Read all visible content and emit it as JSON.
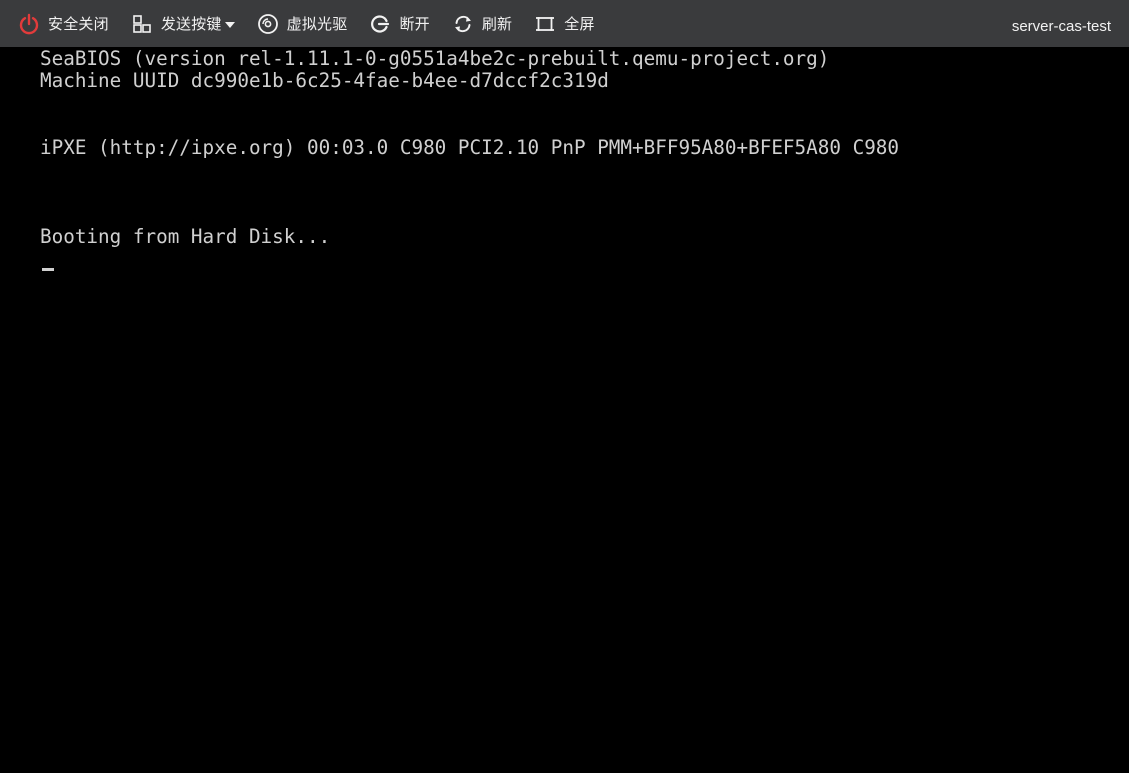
{
  "toolbar": {
    "buttons": [
      {
        "id": "shutdown",
        "label": "安全关闭",
        "icon": "power-icon",
        "color": "#e23b3b"
      },
      {
        "id": "send-keys",
        "label": "发送按键",
        "icon": "keyboard-grid-icon",
        "has_dropdown": true
      },
      {
        "id": "virtual-cd",
        "label": "虚拟光驱",
        "icon": "disc-icon"
      },
      {
        "id": "disconnect",
        "label": "断开",
        "icon": "disconnect-icon"
      },
      {
        "id": "refresh",
        "label": "刷新",
        "icon": "refresh-icon"
      },
      {
        "id": "fullscreen",
        "label": "全屏",
        "icon": "fullscreen-icon"
      }
    ],
    "vm_name": "server-cas-test"
  },
  "console": {
    "lines": [
      "SeaBIOS (version rel-1.11.1-0-g0551a4be2c-prebuilt.qemu-project.org)",
      "Machine UUID dc990e1b-6c25-4fae-b4ee-d7dccf2c319d",
      "iPXE (http://ipxe.org) 00:03.0 C980 PCI2.10 PnP PMM+BFF95A80+BFEF5A80 C980",
      "Booting from Hard Disk..."
    ]
  },
  "colors": {
    "toolbar_bg": "#3a3b3d",
    "console_bg": "#000000",
    "console_text": "#d0d0d0",
    "power_red": "#e23b3b"
  }
}
